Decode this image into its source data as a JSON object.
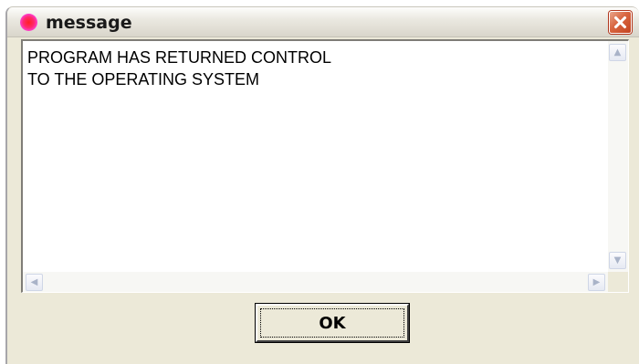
{
  "window": {
    "title": "message",
    "icon": "app-icon"
  },
  "controls": {
    "close_icon": "close-icon"
  },
  "message": {
    "lines": [
      "PROGRAM HAS RETURNED CONTROL",
      "TO THE OPERATING SYSTEM"
    ]
  },
  "scrollbars": {
    "up_arrow": "▲",
    "down_arrow": "▼",
    "left_arrow": "◀",
    "right_arrow": "▶"
  },
  "buttons": {
    "ok_label": "OK"
  },
  "colors": {
    "window_bg": "#ece9d8",
    "close_button": "#d8653f",
    "icon": "#ff2a70"
  }
}
